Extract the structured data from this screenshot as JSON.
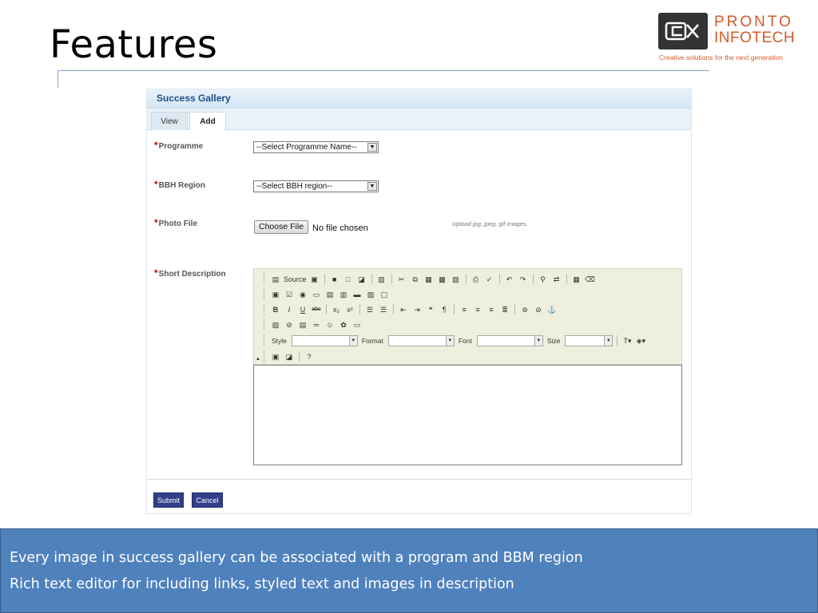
{
  "slide": {
    "title": "Features",
    "bullets": [
      "Every image in success gallery can be associated with a program and BBM region",
      "Rich text editor for including links, styled text and images in description"
    ]
  },
  "logo": {
    "line1": "PRONTO",
    "line2": "INFOTECH",
    "tagline": "Creative solutions for the next generation",
    "color": "#d35a2a"
  },
  "form": {
    "header": "Success Gallery",
    "tabs": [
      {
        "label": "View",
        "active": false
      },
      {
        "label": "Add",
        "active": true
      }
    ],
    "required_marker": "*",
    "fields": {
      "programme": {
        "label": "Programme",
        "value": "--Select Programme Name--"
      },
      "region": {
        "label": "BBH Region",
        "value": "--Select BBH region--"
      },
      "photo": {
        "label": "Photo File",
        "button": "Choose File",
        "status": "No file chosen",
        "hint": "Upload jpg, jpeg, gif images."
      },
      "description": {
        "label": "Short Description"
      }
    },
    "editor": {
      "source_label": "Source",
      "combos": {
        "style": "Style",
        "format": "Format",
        "font": "Font",
        "size": "Size"
      }
    },
    "buttons": {
      "submit": "Submit",
      "cancel": "Cancel"
    },
    "colors": {
      "header_text": "#1e4f8a",
      "button_bg": "#2f3f88",
      "required": "#cc0000"
    }
  },
  "colors": {
    "banner": "#4f81bd",
    "toolbar": "#efefde"
  }
}
